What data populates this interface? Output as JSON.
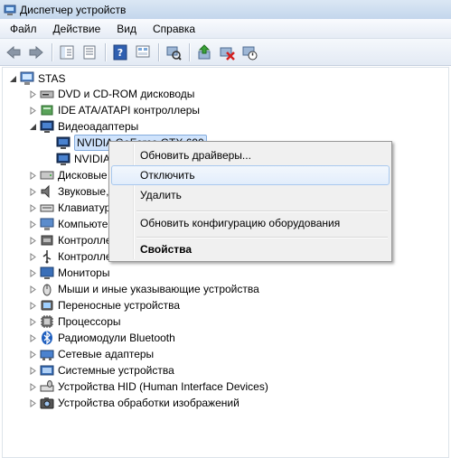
{
  "window": {
    "title": "Диспетчер устройств"
  },
  "menubar": [
    "Файл",
    "Действие",
    "Вид",
    "Справка"
  ],
  "toolbar": {
    "buttons": [
      "back-icon",
      "forward-icon",
      "up-icon",
      "properties-icon",
      "help-icon",
      "scan-icon",
      "update-driver-icon",
      "uninstall-icon",
      "enable-disable-icon"
    ]
  },
  "tree": {
    "root": "STAS",
    "items": [
      {
        "label": "DVD и CD-ROM дисководы"
      },
      {
        "label": "IDE ATA/ATAPI контроллеры"
      },
      {
        "label": "Видеоадаптеры"
      },
      {
        "label": "NVIDIA GeForce GTX 690"
      },
      {
        "label": "NVIDIA"
      },
      {
        "label": "Дисковые"
      },
      {
        "label": "Звуковые,"
      },
      {
        "label": "Клавиатур"
      },
      {
        "label": "Компьюте"
      },
      {
        "label": "Контролле"
      },
      {
        "label": "Контролле"
      },
      {
        "label": "Мониторы"
      },
      {
        "label": "Мыши и иные указывающие устройства"
      },
      {
        "label": "Переносные устройства"
      },
      {
        "label": "Процессоры"
      },
      {
        "label": "Радиомодули Bluetooth"
      },
      {
        "label": "Сетевые адаптеры"
      },
      {
        "label": "Системные устройства"
      },
      {
        "label": "Устройства HID (Human Interface Devices)"
      },
      {
        "label": "Устройства обработки изображений"
      }
    ]
  },
  "context_menu": {
    "items": [
      "Обновить драйверы...",
      "Отключить",
      "Удалить",
      "Обновить конфигурацию оборудования",
      "Свойства"
    ]
  }
}
